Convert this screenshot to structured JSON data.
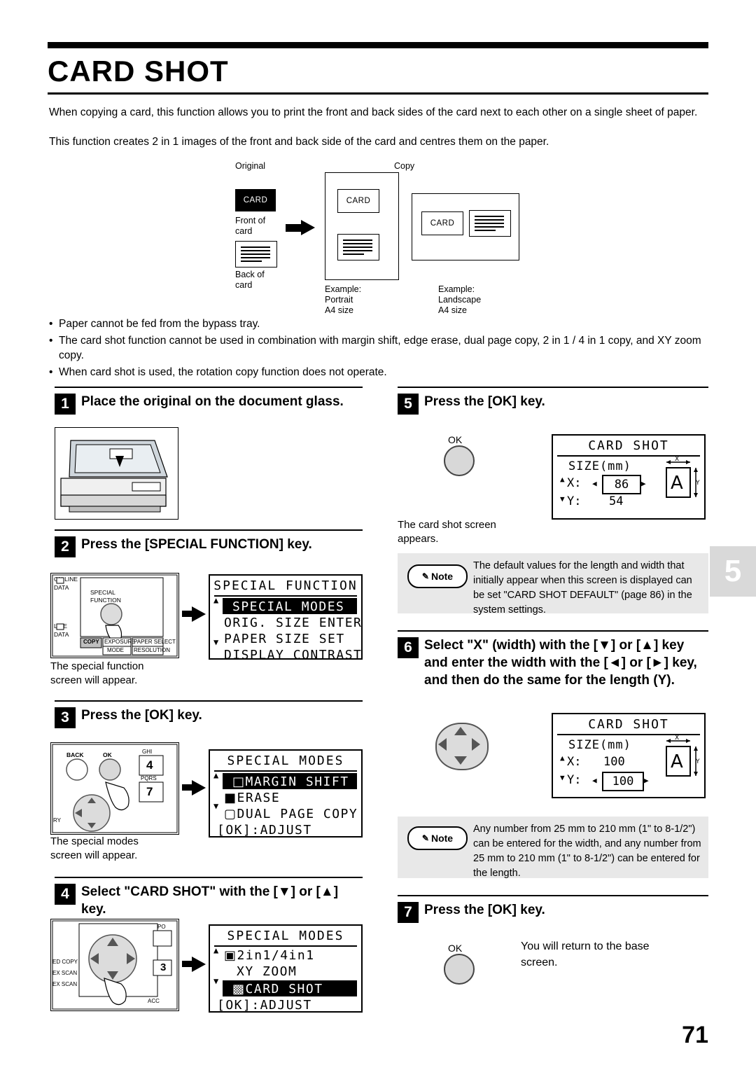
{
  "header": {
    "title": "CARD SHOT",
    "intro_1": "When copying a card, this function allows you to print the front and back sides of the card next to each other on a single sheet of paper.",
    "intro_2": "This function creates 2 in 1 images of the front and back side of the card and centres them on the paper."
  },
  "diagram": {
    "original_label": "Original",
    "copy_label": "Copy",
    "card_front_text": "CARD",
    "front_caption": "Front of\ncard",
    "front_caption_l1": "Front of",
    "front_caption_l2": "card",
    "back_caption_l1": "Back of",
    "back_caption_l2": "card",
    "copy_card_text": "CARD",
    "landscape_card_text": "CARD",
    "example_portrait_l1": "Example:",
    "example_portrait_l2": "Portrait",
    "example_portrait_l3": "A4 size",
    "example_landscape_l1": "Example:",
    "example_landscape_l2": "Landscape",
    "example_landscape_l3": "A4 size"
  },
  "bullets": [
    "Paper cannot be fed from the bypass tray.",
    "The card shot function cannot be used in combination with margin shift, edge erase, dual page copy, 2 in 1 / 4 in 1 copy, and XY zoom copy.",
    "When card shot is used, the rotation copy function does not operate."
  ],
  "steps": {
    "s1": {
      "num": "1",
      "text": "Place the original on the document glass."
    },
    "s2": {
      "num": "2",
      "text": "Press the [SPECIAL FUNCTION] key.",
      "caption_l1": "The special function",
      "caption_l2": "screen will appear.",
      "panel_labels": [
        "ON LINE",
        "DATA",
        "SPECIAL",
        "FUNCTION",
        "LINE",
        "DATA",
        "COPY",
        "EXPOSURE",
        "PAPER SELECT",
        "MODE",
        "RESOLUTION"
      ],
      "lcd": {
        "header": "SPECIAL FUNCTION",
        "rows": [
          {
            "text": "SPECIAL MODES",
            "selected": true
          },
          {
            "text": "ORIG. SIZE ENTER",
            "selected": false
          },
          {
            "text": "PAPER SIZE SET",
            "selected": false
          },
          {
            "text": "DISPLAY CONTRAST",
            "selected": false
          }
        ]
      }
    },
    "s3": {
      "num": "3",
      "text": "Press the [OK] key.",
      "caption_l1": "The special modes",
      "caption_l2": "screen will appear.",
      "panel_labels": [
        "BACK",
        "OK",
        "GHI",
        "4",
        "PQRS",
        "7",
        "RY"
      ],
      "lcd": {
        "header": "SPECIAL MODES",
        "rows": [
          {
            "text": "MARGIN SHIFT",
            "selected": true
          },
          {
            "text": "ERASE",
            "selected": false
          },
          {
            "text": "DUAL PAGE COPY",
            "selected": false
          }
        ],
        "footer": "[OK]:ADJUST"
      }
    },
    "s4": {
      "num": "4",
      "text": "Select \"CARD SHOT\" with the [▼] or [▲] key.",
      "panel_labels": [
        "ED COPY",
        "EX SCAN",
        "EX SCAN",
        "PO",
        "3",
        "ACC"
      ],
      "lcd": {
        "header": "SPECIAL MODES",
        "rows": [
          {
            "text": "2in1/4in1",
            "selected": false
          },
          {
            "text": "XY ZOOM",
            "selected": false
          },
          {
            "text": "CARD SHOT",
            "selected": true
          }
        ],
        "footer": "[OK]:ADJUST"
      }
    },
    "s5": {
      "num": "5",
      "text": "Press the [OK] key.",
      "key_label": "OK",
      "caption_l1": "The card shot screen",
      "caption_l2": "appears.",
      "lcd": {
        "header": "CARD SHOT",
        "size_label": "SIZE(mm)",
        "x_label": "X:",
        "x_value": "86",
        "y_label": "Y:",
        "y_value": "54"
      },
      "note": "The default values for the length and width that initially appear when this screen is displayed can be set \"CARD SHOT DEFAULT\" (page 86) in the system settings.",
      "note_badge": "Note"
    },
    "s6": {
      "num": "6",
      "text": "Select \"X\" (width) with the [▼] or [▲] key and enter the width with the [◄] or [►] key, and then do the same for the length (Y).",
      "lcd": {
        "header": "CARD SHOT",
        "size_label": "SIZE(mm)",
        "x_label": "X:",
        "x_value": "100",
        "y_label": "Y:",
        "y_value": "100"
      },
      "note": "Any number from 25 mm to 210 mm (1\" to 8-1/2\") can be entered for the width, and any number from 25 mm to 210 mm (1\" to 8-1/2\") can be entered for the length.",
      "note_badge": "Note"
    },
    "s7": {
      "num": "7",
      "text": "Press the [OK] key.",
      "key_label": "OK",
      "caption_l1": "You will return to the base",
      "caption_l2": "screen."
    }
  },
  "chapter_tab": "5",
  "page_number": "71"
}
